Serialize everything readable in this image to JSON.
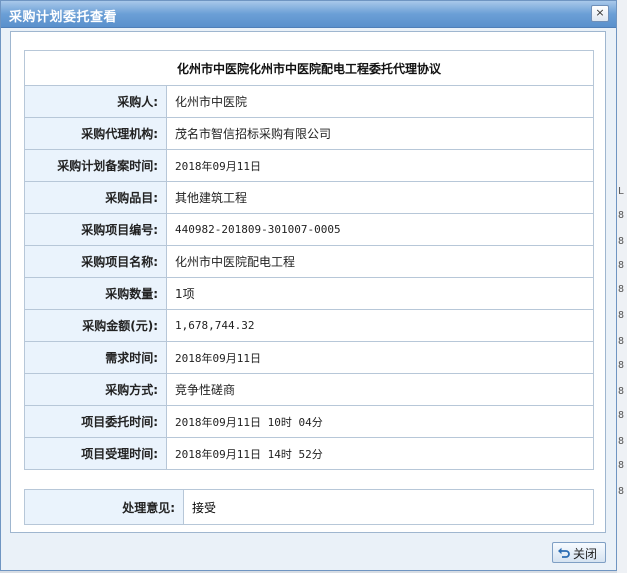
{
  "dialog": {
    "title": "采购计划委托查看",
    "close_glyph": "×",
    "header": "化州市中医院化州市中医院配电工程委托代理协议",
    "rows": [
      {
        "label": "采购人:",
        "value": "化州市中医院"
      },
      {
        "label": "采购代理机构:",
        "value": "茂名市智信招标采购有限公司"
      },
      {
        "label": "采购计划备案时间:",
        "value": "2018年09月11日"
      },
      {
        "label": "采购品目:",
        "value": "其他建筑工程"
      },
      {
        "label": "采购项目编号:",
        "value": "440982-201809-301007-0005"
      },
      {
        "label": "采购项目名称:",
        "value": "化州市中医院配电工程"
      },
      {
        "label": "采购数量:",
        "value": "1项"
      },
      {
        "label": "采购金额(元):",
        "value": "1,678,744.32"
      },
      {
        "label": "需求时间:",
        "value": "2018年09月11日"
      },
      {
        "label": "采购方式:",
        "value": "竞争性磋商"
      },
      {
        "label": "项目委托时间:",
        "value": "2018年09月11日 10时 04分"
      },
      {
        "label": "项目受理时间:",
        "value": "2018年09月11日 14时 52分"
      }
    ],
    "opinion": {
      "label": "处理意见:",
      "value": "接受"
    },
    "close_button": "关闭"
  },
  "background": {
    "row_snippets": [
      "L",
      "8",
      "8",
      "8",
      "8",
      "8",
      "8",
      "8",
      "8",
      "8",
      "8",
      "8",
      "8"
    ]
  }
}
